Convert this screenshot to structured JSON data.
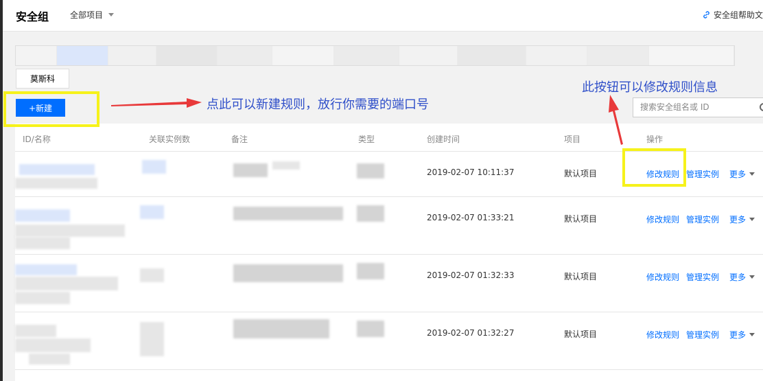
{
  "header": {
    "title": "安全组",
    "project_select": "全部项目",
    "help_link": "安全组帮助文"
  },
  "toolbar": {
    "region_tab": "莫斯科",
    "new_button": "+新建",
    "search_placeholder": "搜索安全组名或 ID"
  },
  "table": {
    "columns": [
      "ID/名称",
      "关联实例数",
      "备注",
      "类型",
      "创建时间",
      "项目",
      "操作"
    ],
    "rows": [
      {
        "created": "2019-02-07 10:11:37",
        "project": "默认项目",
        "edit": "修改规则",
        "manage": "管理实例",
        "more": "更多"
      },
      {
        "created": "2019-02-07 01:33:21",
        "project": "默认项目",
        "edit": "修改规则",
        "manage": "管理实例",
        "more": "更多"
      },
      {
        "created": "2019-02-07 01:32:33",
        "project": "默认项目",
        "edit": "修改规则",
        "manage": "管理实例",
        "more": "更多"
      },
      {
        "created": "2019-02-07 01:32:27",
        "project": "默认项目",
        "edit": "修改规则",
        "manage": "管理实例",
        "more": "更多"
      }
    ]
  },
  "annotations": {
    "new_rule_note": "点此可以新建规则，放行你需要的端口号",
    "edit_rule_note": "此按钮可以修改规则信息",
    "highlight_color": "#f6f21b",
    "arrow_color": "#e8393a",
    "text_color": "#2f4fc9"
  },
  "colors": {
    "primary": "#006eff",
    "background": "#f2f2f2"
  }
}
